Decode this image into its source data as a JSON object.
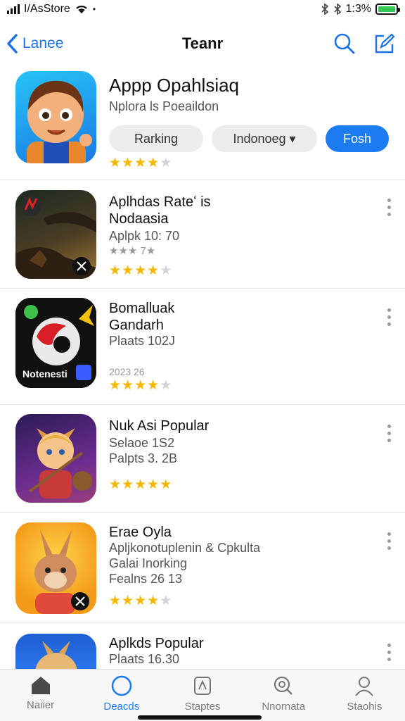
{
  "status": {
    "carrier": "I/AsStore",
    "time": "1:3%"
  },
  "nav": {
    "back_label": "Lanee",
    "title": "Teanr"
  },
  "header_app": {
    "title": "Appp Opahlsiaq",
    "subtitle": "Nplora ls Poeaildon",
    "filters": [
      "Rarking",
      "Indonoeɡ ▾",
      "Fosh"
    ],
    "rating": 4
  },
  "apps": [
    {
      "title": "Aplhdas Rateʻ is\nNodaasia",
      "lines": [
        "Aplpk 10: 70"
      ],
      "tiny": "★★★ 7★",
      "rating": 4
    },
    {
      "title": "Bomalluak\nGandarh",
      "lines": [
        "Plaats 102J"
      ],
      "tiny": "2023 26",
      "rating": 4
    },
    {
      "title": "Nuk Asi Popular",
      "lines": [
        "Selaoe 1S2",
        "Palpts 3. 2B"
      ],
      "tiny": "",
      "rating": 4.5
    },
    {
      "title": "Erae Oyla",
      "lines": [
        "Apljkonotuplenin & Cpkulta",
        "Galai Inorking",
        "Fealns 26 13"
      ],
      "tiny": "",
      "rating": 3.5
    },
    {
      "title": "Aplkds Popular",
      "lines": [
        "Plaats 16.30"
      ],
      "tiny": "",
      "rating": 0
    }
  ],
  "icon_labels": {
    "app2": "Notenesti"
  },
  "tabs": [
    {
      "label": "Naiier",
      "icon": "home-icon"
    },
    {
      "label": "Deacds",
      "icon": "circle-icon"
    },
    {
      "label": "Staptes",
      "icon": "apps-icon"
    },
    {
      "label": "Nnornata",
      "icon": "search-icon"
    },
    {
      "label": "Staohis",
      "icon": "person-icon"
    }
  ],
  "colors": {
    "accent": "#1a7cf0",
    "star": "#f5b800",
    "battery": "#34c759"
  }
}
